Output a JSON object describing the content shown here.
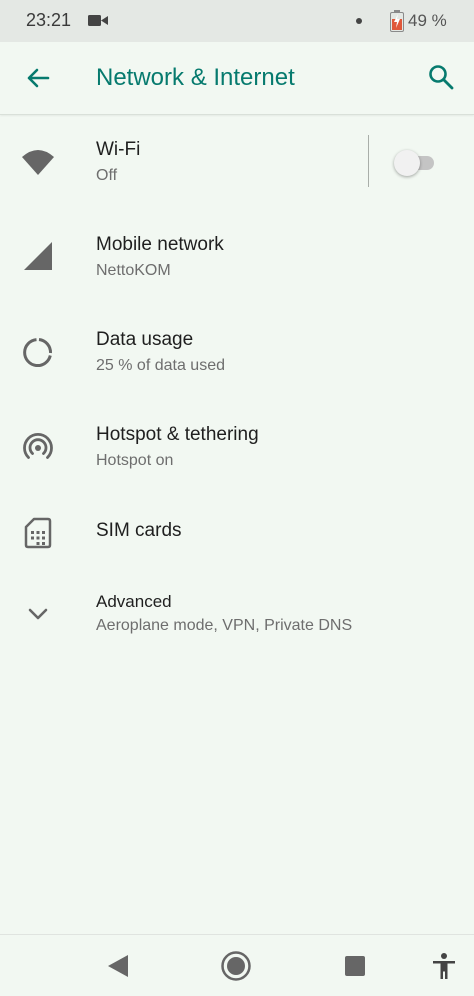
{
  "status_bar": {
    "time": "23:21",
    "battery_text": "49 %",
    "icons": [
      "video-camera-icon",
      "notification-dot-icon",
      "battery-icon"
    ]
  },
  "app_bar": {
    "title": "Network & Internet",
    "back_icon": "arrow-back-icon",
    "search_icon": "search-icon"
  },
  "items": [
    {
      "title": "Wi-Fi",
      "summary": "Off",
      "icon": "wifi-icon",
      "toggle_on": false
    },
    {
      "title": "Mobile network",
      "summary": "NettoKOM",
      "icon": "cellular-signal-icon"
    },
    {
      "title": "Data usage",
      "summary": "25 % of data used",
      "icon": "data-usage-icon"
    },
    {
      "title": "Hotspot & tethering",
      "summary": "Hotspot on",
      "icon": "hotspot-icon"
    },
    {
      "title": "SIM cards",
      "summary": "",
      "icon": "sim-card-icon"
    },
    {
      "title": "Advanced",
      "summary": "Aeroplane mode, VPN, Private DNS",
      "icon": "chevron-down-icon"
    }
  ],
  "nav_bar": {
    "icons": [
      "nav-back-icon",
      "nav-home-icon",
      "nav-recents-icon",
      "accessibility-icon"
    ]
  },
  "colors": {
    "accent": "#067a6e",
    "background": "#f2f8f2",
    "icon_gray": "#666666",
    "battery_low": "#e0583a"
  }
}
